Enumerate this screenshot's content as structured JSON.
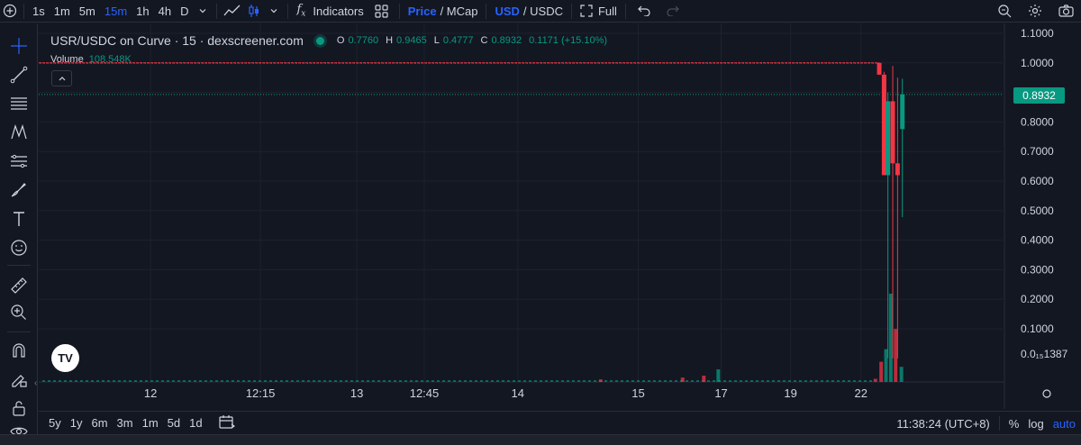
{
  "toolbar": {
    "intervals": [
      "1s",
      "1m",
      "5m",
      "15m",
      "1h",
      "4h",
      "D"
    ],
    "active_interval": "15m",
    "indicators_label": "Indicators",
    "price_label": "Price",
    "mcap_label": "/ MCap",
    "usd_label": "USD",
    "usdc_label": "/ USDC",
    "full_label": "Full"
  },
  "legend": {
    "title": "USR/USDC on Curve · 15 · dexscreener.com",
    "o_label": "O",
    "o_value": "0.7760",
    "h_label": "H",
    "h_value": "0.9465",
    "l_label": "L",
    "l_value": "0.4777",
    "c_label": "C",
    "c_value": "0.8932",
    "change": "0.1171 (+15.10%)",
    "volume_label": "Volume",
    "volume_value": "108.548K"
  },
  "price_tag": "0.8932",
  "logo_text": "TV",
  "bottombar": {
    "ranges": [
      "5y",
      "1y",
      "6m",
      "3m",
      "1m",
      "5d",
      "1d"
    ],
    "time": "11:38:24 (UTC+8)",
    "percent": "%",
    "log": "log",
    "auto": "auto"
  },
  "colors": {
    "background": "#131722",
    "up": "#089981",
    "down": "#f23645",
    "grid": "#1e222d",
    "accent": "#2962ff"
  },
  "chart_data": {
    "type": "candlestick",
    "title": "USR/USDC on Curve · 15 · dexscreener.com",
    "y_ticks": [
      "1.1000",
      "1.0000",
      "0.9000",
      "0.8000",
      "0.7000",
      "0.6000",
      "0.5000",
      "0.4000",
      "0.3000",
      "0.2000",
      "0.1000"
    ],
    "y_tick_values": [
      1.1,
      1.0,
      0.9,
      0.8,
      0.7,
      0.6,
      0.5,
      0.4,
      0.3,
      0.2,
      0.1
    ],
    "y_bottom_label": "0.0₁₅1387",
    "ylim": [
      0.0,
      1.12
    ],
    "x_ticks": [
      "12",
      "12:15",
      "13",
      "12:45",
      "14",
      "15",
      "17",
      "19",
      "22"
    ],
    "x_tick_fraction": [
      0.116,
      0.23,
      0.33,
      0.4,
      0.497,
      0.622,
      0.708,
      0.78,
      0.853
    ],
    "pre_crash_level": 1.0,
    "last_close": 0.8932,
    "recent_candles": [
      {
        "x_frac": 0.872,
        "o": 1.0,
        "h": 1.0,
        "l": 0.96,
        "c": 0.96
      },
      {
        "x_frac": 0.877,
        "o": 0.96,
        "h": 0.97,
        "l": 0.62,
        "c": 0.62
      },
      {
        "x_frac": 0.881,
        "o": 0.62,
        "h": 0.9,
        "l": 0.0,
        "c": 0.87
      },
      {
        "x_frac": 0.886,
        "o": 0.87,
        "h": 0.99,
        "l": 0.0,
        "c": 0.66
      },
      {
        "x_frac": 0.891,
        "o": 0.66,
        "h": 0.95,
        "l": 0.0,
        "c": 0.62
      },
      {
        "x_frac": 0.896,
        "o": 0.776,
        "h": 0.9465,
        "l": 0.4777,
        "c": 0.8932
      }
    ],
    "volume": [
      {
        "x_frac": 0.583,
        "v": 0.2,
        "dir": "down"
      },
      {
        "x_frac": 0.668,
        "v": 0.35,
        "dir": "down"
      },
      {
        "x_frac": 0.69,
        "v": 0.5,
        "dir": "down"
      },
      {
        "x_frac": 0.705,
        "v": 1.0,
        "dir": "up"
      },
      {
        "x_frac": 0.868,
        "v": 0.25,
        "dir": "down"
      },
      {
        "x_frac": 0.874,
        "v": 1.6,
        "dir": "down"
      },
      {
        "x_frac": 0.879,
        "v": 2.6,
        "dir": "up"
      },
      {
        "x_frac": 0.884,
        "v": 7.0,
        "dir": "up"
      },
      {
        "x_frac": 0.889,
        "v": 4.2,
        "dir": "down"
      },
      {
        "x_frac": 0.895,
        "v": 1.2,
        "dir": "up"
      }
    ]
  }
}
